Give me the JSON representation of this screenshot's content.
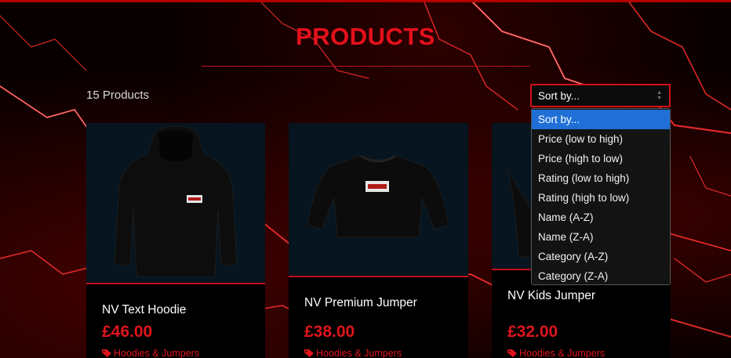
{
  "page": {
    "title": "PRODUCTS"
  },
  "toolbar": {
    "product_count": "15 Products",
    "sort_value": "Sort by...",
    "sort_options": [
      "Sort by...",
      "Price (low to high)",
      "Price (high to low)",
      "Rating (low to high)",
      "Rating (high to low)",
      "Name (A-Z)",
      "Name (Z-A)",
      "Category (A-Z)",
      "Category (Z-A)"
    ],
    "sort_selected_index": 0
  },
  "products": [
    {
      "name": "NV Text Hoodie",
      "price": "£46.00",
      "category": "Hoodies & Jumpers",
      "icon": "hoodie-image"
    },
    {
      "name": "NV Premium Jumper",
      "price": "£38.00",
      "category": "Hoodies & Jumpers",
      "icon": "jumper-image"
    },
    {
      "name": "NV Kids Jumper",
      "price": "£32.00",
      "category": "Hoodies & Jumpers",
      "icon": "kids-jumper-image"
    }
  ],
  "colors": {
    "accent": "#e0141d",
    "highlight": "#1f6fd6",
    "card_image_bg": "#061520"
  }
}
